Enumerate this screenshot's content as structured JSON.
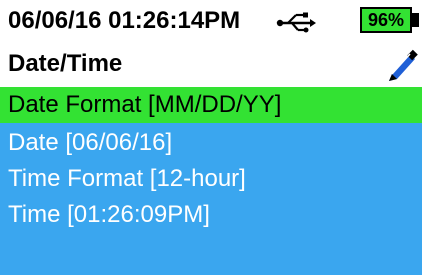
{
  "status": {
    "datetime": "06/06/16  01:26:14PM",
    "usb_icon": "usb-icon",
    "battery": "96%",
    "colors": {
      "battery_fill": "#33e233"
    }
  },
  "header": {
    "title": "Date/Time",
    "edit_icon": "pen-icon"
  },
  "menu": {
    "items": [
      {
        "label": "Date Format [MM/DD/YY]",
        "selected": true
      },
      {
        "label": "Date [06/06/16]",
        "selected": false
      },
      {
        "label": "Time Format [12-hour]",
        "selected": false
      },
      {
        "label": "Time [01:26:09PM]",
        "selected": false
      }
    ],
    "colors": {
      "background": "#3aa6ef",
      "selected": "#33e233"
    }
  }
}
